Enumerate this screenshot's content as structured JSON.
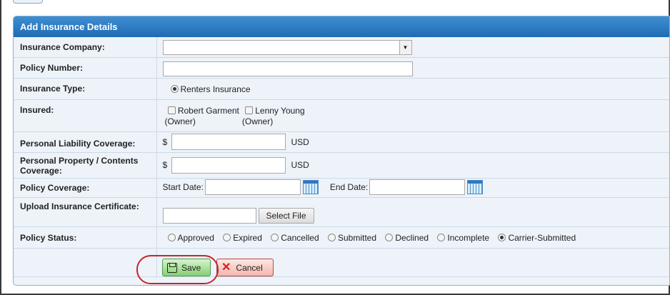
{
  "panel": {
    "title": "Add Insurance Details"
  },
  "fields": {
    "insurance_company": {
      "label": "Insurance Company:",
      "value": ""
    },
    "policy_number": {
      "label": "Policy Number:",
      "value": ""
    },
    "insurance_type": {
      "label": "Insurance Type:",
      "option": "Renters Insurance",
      "selected": true
    },
    "insured": {
      "label": "Insured:",
      "people": [
        {
          "name": "Robert Garment",
          "role": "(Owner)",
          "checked": false
        },
        {
          "name": "Lenny Young",
          "role": "(Owner)",
          "checked": false
        }
      ]
    },
    "personal_liability": {
      "label": "Personal Liability Coverage:",
      "currency_symbol": "$",
      "value": "",
      "unit": "USD"
    },
    "personal_property": {
      "label": "Personal Property / Contents Coverage:",
      "currency_symbol": "$",
      "value": "",
      "unit": "USD"
    },
    "policy_coverage": {
      "label": "Policy Coverage:",
      "start_label": "Start Date:",
      "start_value": "",
      "end_label": "End Date:",
      "end_value": ""
    },
    "upload_certificate": {
      "label": "Upload Insurance Certificate:",
      "file_value": "",
      "button_label": "Select File"
    },
    "policy_status": {
      "label": "Policy Status:",
      "options": [
        "Approved",
        "Expired",
        "Cancelled",
        "Submitted",
        "Declined",
        "Incomplete",
        "Carrier-Submitted"
      ],
      "selected": "Carrier-Submitted"
    }
  },
  "buttons": {
    "save_label": "Save",
    "cancel_label": "Cancel"
  },
  "colors": {
    "header": "#2a7cc6",
    "highlight_ring": "#c4262e",
    "save_bg": "#9bd888",
    "cancel_bg": "#f3b6ac"
  }
}
